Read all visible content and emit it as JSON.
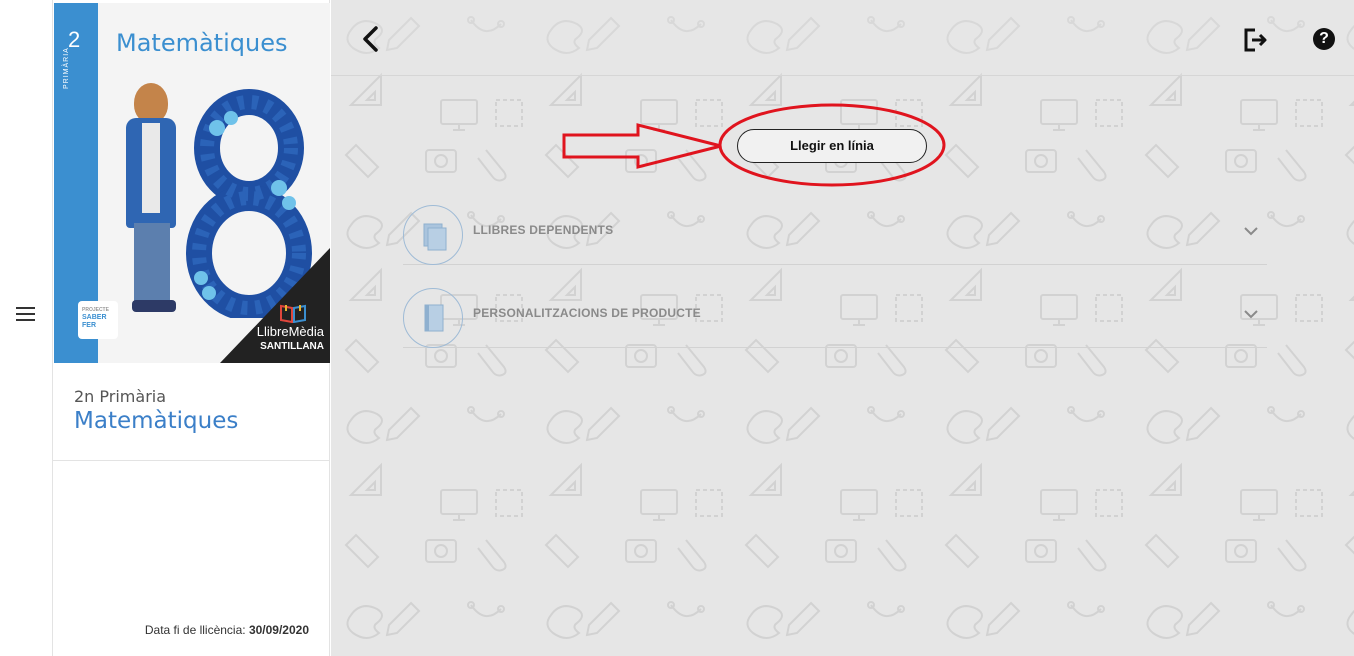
{
  "book": {
    "grade_number": "2",
    "cover_vertical_label": "PRIMÀRIA",
    "cover_title": "Matemàtiques",
    "badge_text_top": "PROJECTE",
    "badge_text_1": "SABER",
    "badge_text_2": "FER",
    "brand_line1": "LlibreMèdia",
    "brand_line2": "SANTILLANA",
    "grade_label": "2n Primària",
    "subject": "Matemàtiques",
    "license_label": "Data fi de llicència:",
    "license_date": "30/09/2020"
  },
  "main": {
    "read_online_label": "Llegir en línia",
    "sections": [
      {
        "label": "LLIBRES DEPENDENTS"
      },
      {
        "label": "PERSONALITZACIONS DE PRODUCTE"
      }
    ]
  },
  "toolbar": {
    "help_glyph": "?"
  },
  "icons": {
    "menu": "hamburger-menu-icon",
    "back": "chevron-left-icon",
    "exit": "logout-icon",
    "help": "help-icon",
    "expand": "chevron-down-icon"
  },
  "colors": {
    "accent_blue": "#3b8fd0",
    "annotation_red": "#e0141e",
    "background": "#e6e6e6"
  }
}
